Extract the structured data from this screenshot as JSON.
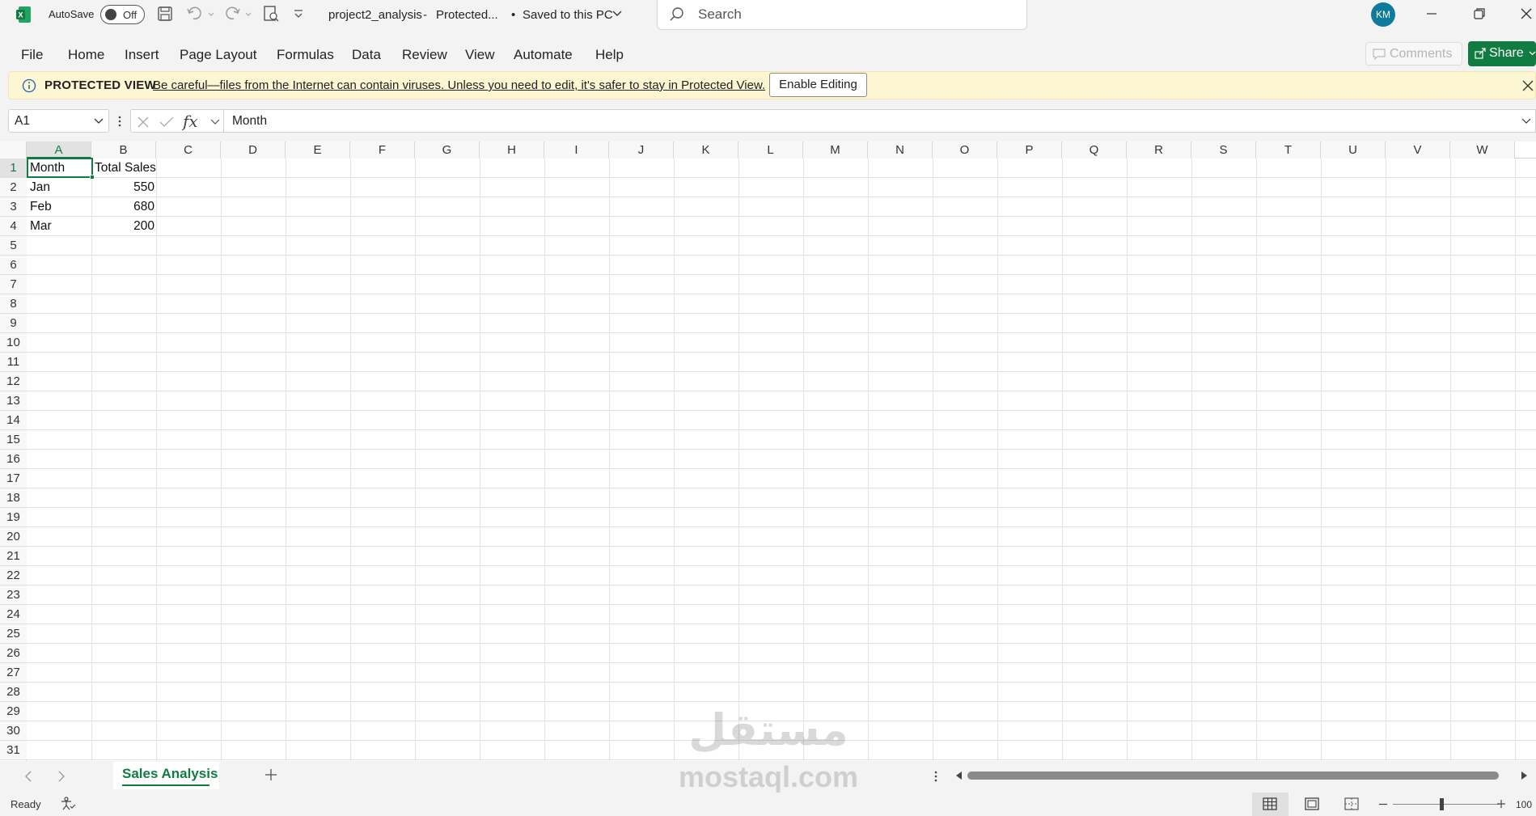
{
  "titlebar": {
    "autosave_label": "AutoSave",
    "autosave_state": "Off",
    "doc_name": "project2_analysis",
    "protected_label": "Protected...",
    "save_status": "Saved to this PC",
    "search_placeholder": "Search",
    "user_initials": "KM"
  },
  "ribbon": {
    "tabs": [
      "File",
      "Home",
      "Insert",
      "Page Layout",
      "Formulas",
      "Data",
      "Review",
      "View",
      "Automate",
      "Help"
    ],
    "comments_label": "Comments",
    "share_label": "Share"
  },
  "protected_view": {
    "title": "PROTECTED VIEW",
    "message": "Be careful—files from the Internet can contain viruses. Unless you need to edit, it's safer to stay in Protected View.",
    "button": "Enable Editing"
  },
  "formula_bar": {
    "name_box": "A1",
    "formula": "Month",
    "fx": "fx"
  },
  "grid": {
    "columns": [
      "A",
      "B",
      "C",
      "D",
      "E",
      "F",
      "G",
      "H",
      "I",
      "J",
      "K",
      "L",
      "M",
      "N",
      "O",
      "P",
      "Q",
      "R",
      "S",
      "T",
      "U",
      "V",
      "W"
    ],
    "rows": [
      "1",
      "2",
      "3",
      "4",
      "5",
      "6",
      "7",
      "8",
      "9",
      "10",
      "11",
      "12",
      "13",
      "14",
      "15",
      "16",
      "17",
      "18",
      "19",
      "20",
      "21",
      "22",
      "23",
      "24",
      "25",
      "26",
      "27",
      "28",
      "29",
      "30",
      "31"
    ],
    "cells": {
      "A1": "Month",
      "B1": "Total Sales",
      "A2": "Jan",
      "B2": "550",
      "A3": "Feb",
      "B3": "680",
      "A4": "Mar",
      "B4": "200"
    },
    "selected_cell": "A1"
  },
  "sheets": {
    "active": "Sales Analysis"
  },
  "watermark": {
    "arabic": "مستقل",
    "latin": "mostaql.com"
  },
  "status": {
    "ready": "Ready",
    "zoom": "100"
  },
  "colors": {
    "excel_green": "#107c41",
    "protected_bg": "#fdf6d3",
    "avatar": "#0f7b9c"
  }
}
